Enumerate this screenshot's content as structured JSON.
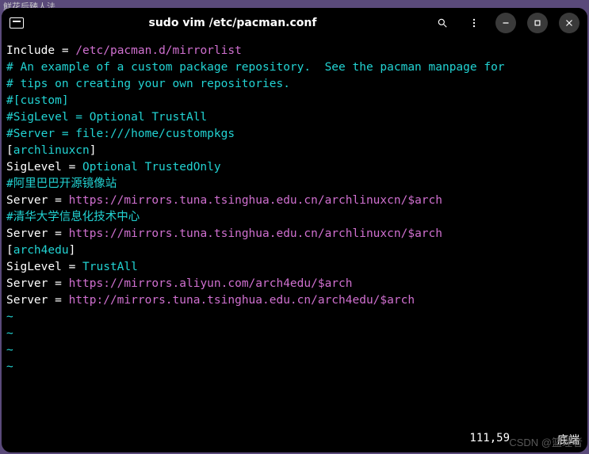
{
  "partial_header": "鲜花后臻人法",
  "titlebar": {
    "title": "sudo vim /etc/pacman.conf",
    "icon": "terminal-app-icon",
    "search_icon": "search-icon",
    "menu_icon": "kebab-menu-icon",
    "minimize_icon": "minimize-icon",
    "maximize_icon": "maximize-icon",
    "close_icon": "close-icon"
  },
  "editor": {
    "lines": [
      {
        "segments": [
          {
            "t": "Include = ",
            "c": "c-default"
          },
          {
            "t": "/etc/pacman.d/mirrorlist",
            "c": "c-purple"
          }
        ]
      },
      {
        "segments": [
          {
            "t": "",
            "c": "c-default"
          }
        ]
      },
      {
        "segments": [
          {
            "t": "# An example of a custom package repository.  See the pacman manpage for",
            "c": "c-comment"
          }
        ]
      },
      {
        "segments": [
          {
            "t": "# tips on creating your own repositories.",
            "c": "c-comment"
          }
        ]
      },
      {
        "segments": [
          {
            "t": "#[custom]",
            "c": "c-comment"
          }
        ]
      },
      {
        "segments": [
          {
            "t": "#SigLevel = Optional TrustAll",
            "c": "c-comment"
          }
        ]
      },
      {
        "segments": [
          {
            "t": "#Server = file:///home/custompkgs",
            "c": "c-comment"
          }
        ]
      },
      {
        "segments": [
          {
            "t": "",
            "c": "c-default"
          }
        ]
      },
      {
        "segments": [
          {
            "t": "[",
            "c": "c-default"
          },
          {
            "t": "archlinuxcn",
            "c": "c-cyan"
          },
          {
            "t": "]",
            "c": "c-default"
          }
        ]
      },
      {
        "segments": [
          {
            "t": "SigLevel = ",
            "c": "c-default"
          },
          {
            "t": "Optional TrustedOnly",
            "c": "c-cyan"
          }
        ]
      },
      {
        "segments": [
          {
            "t": "#阿里巴巴开源镜像站",
            "c": "c-comment"
          }
        ]
      },
      {
        "segments": [
          {
            "t": "Server = ",
            "c": "c-default"
          },
          {
            "t": "https://mirrors.tuna.tsinghua.edu.cn/archlinuxcn/$arch",
            "c": "c-purple"
          }
        ]
      },
      {
        "segments": [
          {
            "t": "#清华大学信息化技术中心",
            "c": "c-comment"
          }
        ]
      },
      {
        "segments": [
          {
            "t": "Server = ",
            "c": "c-default"
          },
          {
            "t": "https://mirrors.tuna.tsinghua.edu.cn/archlinuxcn/$arch",
            "c": "c-purple"
          }
        ]
      },
      {
        "segments": [
          {
            "t": "",
            "c": "c-default"
          }
        ]
      },
      {
        "segments": [
          {
            "t": "[",
            "c": "c-default"
          },
          {
            "t": "arch4edu",
            "c": "c-cyan"
          },
          {
            "t": "]",
            "c": "c-default"
          }
        ]
      },
      {
        "segments": [
          {
            "t": "SigLevel = ",
            "c": "c-default"
          },
          {
            "t": "TrustAll",
            "c": "c-cyan"
          }
        ]
      },
      {
        "segments": [
          {
            "t": "Server = ",
            "c": "c-default"
          },
          {
            "t": "https://mirrors.aliyun.com/arch4edu/$arch",
            "c": "c-purple"
          }
        ]
      },
      {
        "segments": [
          {
            "t": "Server = ",
            "c": "c-default"
          },
          {
            "t": "http://mirrors.tuna.tsinghua.edu.cn/arch4edu/$arch",
            "c": "c-purple"
          }
        ]
      }
    ],
    "tildes": [
      "~",
      "~",
      "~",
      "~"
    ]
  },
  "status": {
    "position": "111,59",
    "location": "底端"
  },
  "watermark": "CSDN @篮理者"
}
